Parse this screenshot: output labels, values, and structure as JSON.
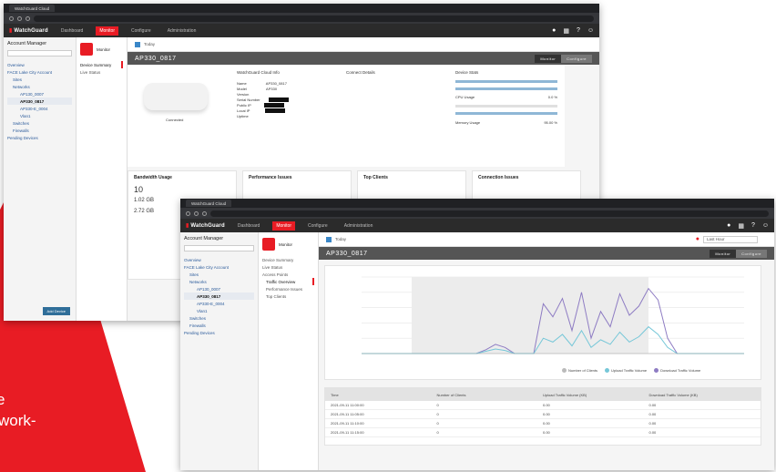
{
  "promo": {
    "line1": "e",
    "line2": "work-"
  },
  "colors": {
    "brand_red": "#e81c24",
    "chart_series_1": "#8e7cc3",
    "chart_series_2": "#76c7d8"
  },
  "back_window": {
    "tab_title": "WatchGuard Cloud",
    "url": "",
    "logo": "WatchGuard",
    "nav": [
      "Dashboard",
      "Monitor",
      "Configure",
      "Administration"
    ],
    "active_nav": "Monitor",
    "account_manager": {
      "title": "Account Manager",
      "tree": [
        "Overview",
        "FACE Lake City Account",
        "Sites",
        "Networks",
        "AP130_0007",
        "AP330_0817",
        "AP330-E_0004",
        "Vlan1",
        "Switches",
        "Firewalls",
        "Pending Devices"
      ],
      "selected": "AP330_0817",
      "new_button": "Add Device"
    },
    "subnav": {
      "header": "Monitor",
      "items": [
        "Device Summary",
        "Live Status"
      ],
      "active": "Device Summary"
    },
    "breadcrumb": "Today",
    "device_name": "AP330_0817",
    "toggle": [
      "Monitor",
      "Configure"
    ],
    "device_info_title": "WatchGuard Cloud Info",
    "device_info": [
      [
        "Name",
        "AP330_0817"
      ],
      [
        "Model",
        "AP330"
      ],
      [
        "Version",
        ""
      ],
      [
        "Serial Number",
        ""
      ],
      [
        "Public IP",
        ""
      ],
      [
        "Local IP",
        ""
      ],
      [
        "Uptime",
        ""
      ]
    ],
    "connection_status": "Connected",
    "connect_details_title": "Connect Details",
    "device_stats_title": "Device Stats",
    "cpu_usage_label": "CPU Usage",
    "cpu_usage_value": "0.0 %",
    "memory_usage_label": "Memory Usage",
    "memory_usage_value": "95.00 %",
    "bottom_cards": [
      "Bandwidth Usage",
      "Performance Issues",
      "Top Clients",
      "Connection Issues"
    ],
    "bandwidth_values": [
      "10",
      "1.02 GB",
      "2.72 GB"
    ]
  },
  "front_window": {
    "tab_title": "WatchGuard Cloud",
    "url": "",
    "logo": "WatchGuard",
    "nav": [
      "Dashboard",
      "Monitor",
      "Configure",
      "Administration"
    ],
    "active_nav": "Monitor",
    "account_manager": {
      "title": "Account Manager",
      "tree": [
        "Overview",
        "FACE Lake City Account",
        "Sites",
        "Networks",
        "AP130_0007",
        "AP330_0817",
        "AP330-E_0004",
        "Vlan1",
        "Switches",
        "Firewalls",
        "Pending Devices"
      ],
      "selected": "AP330_0817",
      "new_button": "Add Device"
    },
    "subnav": {
      "header": "Monitor",
      "items": [
        "Device Summary",
        "Live Status",
        "Access Points",
        "Traffic Overview",
        "Performance Issues",
        "Top Clients"
      ],
      "active": "Traffic Overview"
    },
    "breadcrumb": "Today",
    "range_select": "Last Hour",
    "device_name": "AP330_0817",
    "toggle": [
      "Monitor",
      "Configure"
    ],
    "chart_legend": [
      "Number of Clients",
      "Upload Traffic Volume",
      "Download Traffic Volume"
    ],
    "table_headers": [
      "Time",
      "Number of Clients",
      "Upload Traffic Volume (KB)",
      "Download Traffic Volume (KB)"
    ],
    "table_rows": [
      [
        "2021-09-11 11:00:00",
        "0",
        "0.00",
        "0.00"
      ],
      [
        "2021-09-11 11:05:00",
        "0",
        "0.00",
        "0.00"
      ],
      [
        "2021-09-11 11:10:00",
        "0",
        "0.00",
        "0.00"
      ],
      [
        "2021-09-11 11:15:00",
        "0",
        "0.00",
        "0.00"
      ]
    ]
  },
  "chart_data": {
    "type": "line",
    "title": "",
    "xlabel": "",
    "ylabel": "",
    "ylim": [
      0,
      100
    ],
    "x": [
      0,
      1,
      2,
      3,
      4,
      5,
      6,
      7,
      8,
      9,
      10,
      11,
      12,
      13,
      14,
      15,
      16,
      17,
      18,
      19,
      20,
      21,
      22,
      23,
      24,
      25,
      26,
      27,
      28,
      29,
      30,
      31,
      32,
      33,
      34,
      35,
      36,
      37,
      38,
      39,
      40
    ],
    "series": [
      {
        "name": "Download Traffic Volume",
        "values": [
          0,
          0,
          0,
          0,
          0,
          0,
          0,
          0,
          0,
          0,
          0,
          0,
          0,
          5,
          12,
          8,
          0,
          0,
          0,
          65,
          48,
          72,
          30,
          80,
          20,
          55,
          35,
          78,
          50,
          62,
          85,
          70,
          20,
          0,
          0,
          0,
          0,
          0,
          0,
          0,
          0
        ]
      },
      {
        "name": "Upload Traffic Volume",
        "values": [
          0,
          0,
          0,
          0,
          0,
          0,
          0,
          0,
          0,
          0,
          0,
          0,
          0,
          3,
          6,
          4,
          0,
          0,
          0,
          20,
          15,
          25,
          10,
          30,
          8,
          18,
          12,
          28,
          15,
          22,
          35,
          25,
          8,
          0,
          0,
          0,
          0,
          0,
          0,
          0,
          0
        ]
      }
    ]
  }
}
